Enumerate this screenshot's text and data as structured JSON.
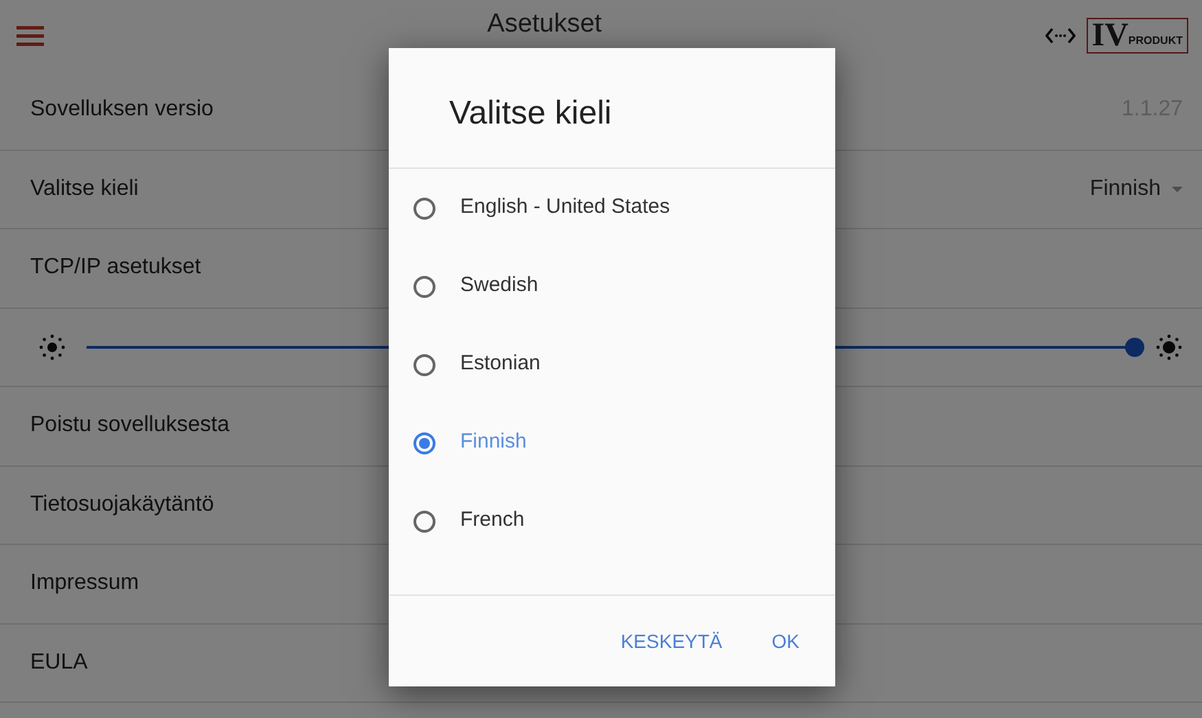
{
  "app_bar": {
    "title": "Asetukset",
    "logo": {
      "mark": "IV",
      "text": "PRODUKT"
    }
  },
  "settings": [
    {
      "kind": "value",
      "label": "Sovelluksen versio",
      "value": "1.1.27"
    },
    {
      "kind": "dropdown",
      "label": "Valitse kieli",
      "value": "Finnish"
    },
    {
      "kind": "link",
      "label": "TCP/IP asetukset"
    },
    {
      "kind": "slider",
      "level": 1.0
    },
    {
      "kind": "link",
      "label": "Poistu sovelluksesta"
    },
    {
      "kind": "link",
      "label": "Tietosuojakäytäntö"
    },
    {
      "kind": "link",
      "label": "Impressum"
    },
    {
      "kind": "link",
      "label": "EULA"
    }
  ],
  "dialog": {
    "title": "Valitse kieli",
    "options": [
      {
        "label": "English - United States",
        "selected": false
      },
      {
        "label": "Swedish",
        "selected": false
      },
      {
        "label": "Estonian",
        "selected": false
      },
      {
        "label": "Finnish",
        "selected": true
      },
      {
        "label": "French",
        "selected": false
      }
    ],
    "buttons": [
      "KESKEYTÄ",
      "OK"
    ]
  }
}
